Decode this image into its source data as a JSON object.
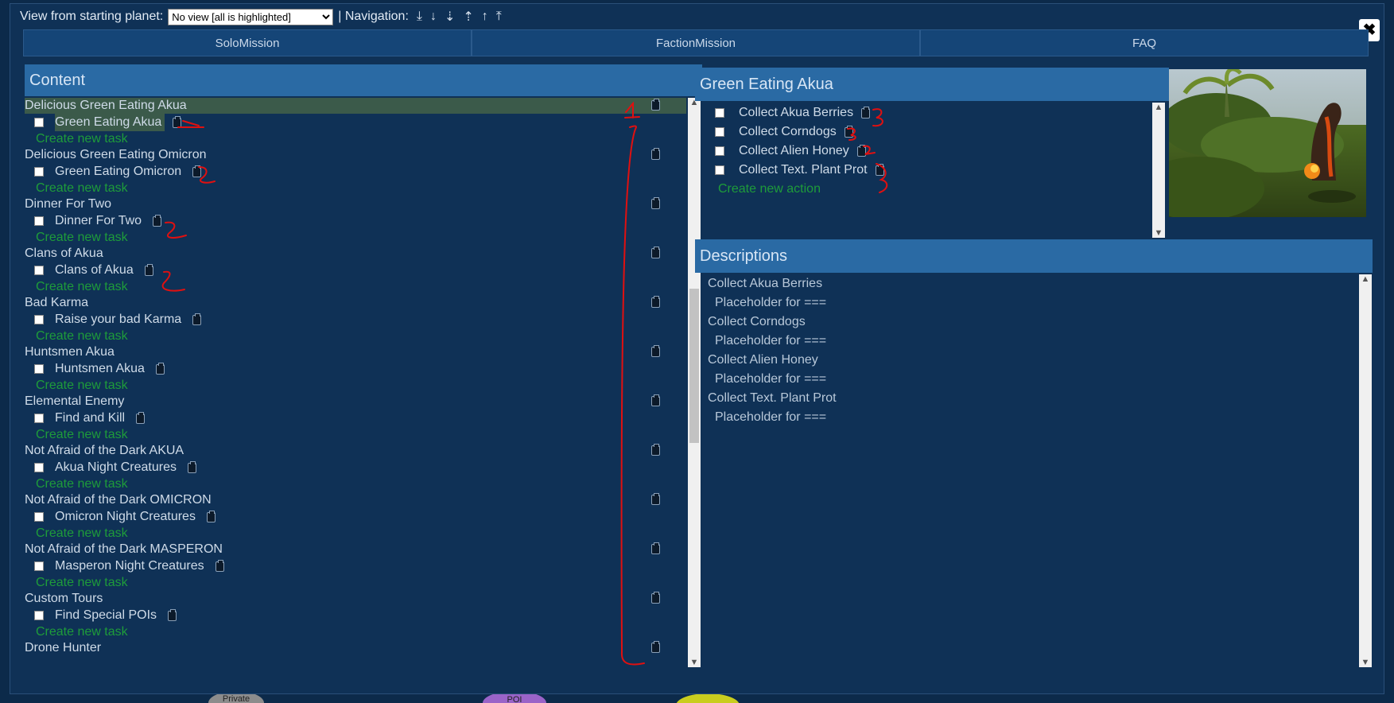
{
  "topbar": {
    "view_label": "View from starting planet:",
    "view_select": "No view [all is highlighted]",
    "navigation_label": "| Navigation:",
    "nav_arrows": [
      "⤓",
      "↓",
      "⇣",
      "⇡",
      "↑",
      "⤒"
    ]
  },
  "close_button": "✖",
  "tabs": [
    {
      "label": "SoloMission"
    },
    {
      "label": "FactionMission"
    },
    {
      "label": "FAQ"
    }
  ],
  "content": {
    "title": "Content",
    "create_task_label": "Create new task",
    "missions": [
      {
        "name": "Delicious Green Eating Akua",
        "task": "Green Eating Akua",
        "selected": true
      },
      {
        "name": "Delicious Green Eating Omicron",
        "task": "Green Eating Omicron"
      },
      {
        "name": "Dinner For Two",
        "task": "Dinner For Two"
      },
      {
        "name": "Clans of Akua",
        "task": "Clans of Akua"
      },
      {
        "name": "Bad Karma",
        "task": "Raise your bad Karma"
      },
      {
        "name": "Huntsmen Akua",
        "task": "Huntsmen Akua"
      },
      {
        "name": "Elemental Enemy",
        "task": "Find and Kill"
      },
      {
        "name": "Not Afraid of the Dark AKUA",
        "task": "Akua Night Creatures"
      },
      {
        "name": "Not Afraid of the Dark OMICRON",
        "task": "Omicron Night Creatures"
      },
      {
        "name": "Not Afraid of the Dark MASPERON",
        "task": "Masperon Night Creatures"
      },
      {
        "name": "Custom Tours",
        "task": "Find Special POIs"
      },
      {
        "name": "Drone Hunter",
        "task": ""
      }
    ]
  },
  "mission_detail": {
    "title": "Green Eating Akua",
    "actions": [
      "Collect Akua Berries",
      "Collect Corndogs",
      "Collect Alien Honey",
      "Collect Text. Plant Prot"
    ],
    "create_action_label": "Create new action"
  },
  "descriptions": {
    "title": "Descriptions",
    "items": [
      {
        "title": "Collect Akua Berries",
        "text": "Placeholder for ==="
      },
      {
        "title": "Collect Corndogs",
        "text": "Placeholder for ==="
      },
      {
        "title": "Collect Alien Honey",
        "text": "Placeholder for ==="
      },
      {
        "title": "Collect Text. Plant Prot",
        "text": "Placeholder for ==="
      }
    ]
  },
  "map_labels": {
    "private": "Private",
    "poi": "POI"
  },
  "annotations": {
    "color": "#e01010",
    "marks": [
      "1",
      "2",
      "2",
      "2",
      "2",
      "3",
      "3",
      "2",
      "3"
    ]
  },
  "colors": {
    "panel_header": "#2a6aa4",
    "create_link": "#1e9c3a",
    "background": "#0f3156"
  }
}
